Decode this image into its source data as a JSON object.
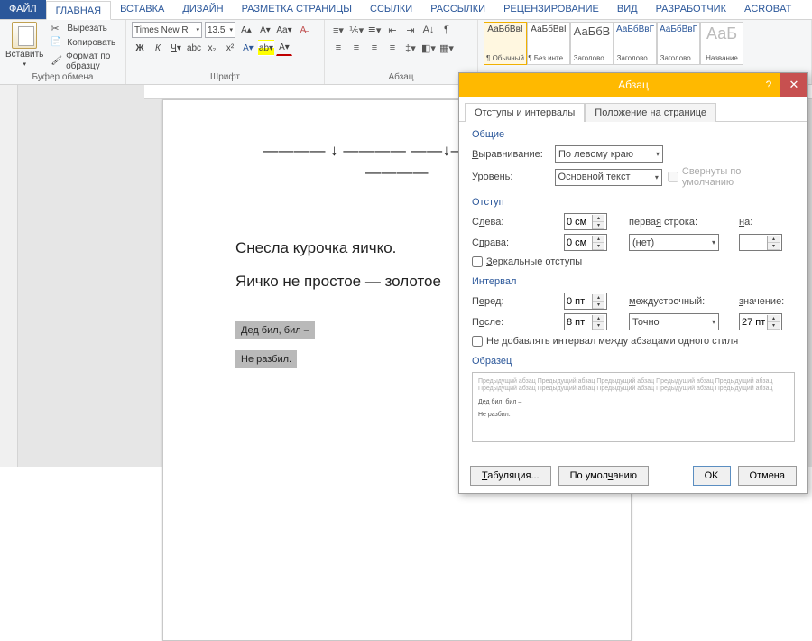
{
  "tabs": {
    "file": "ФАЙЛ",
    "items": [
      "ГЛАВНАЯ",
      "ВСТАВКА",
      "ДИЗАЙН",
      "РАЗМЕТКА СТРАНИЦЫ",
      "ССЫЛКИ",
      "РАССЫЛКИ",
      "РЕЦЕНЗИРОВАНИЕ",
      "ВИД",
      "РАЗРАБОТЧИК",
      "ACROBAT"
    ]
  },
  "clipboard": {
    "paste": "Вставить",
    "cut": "Вырезать",
    "copy": "Копировать",
    "format": "Формат по образцу",
    "group": "Буфер обмена"
  },
  "font": {
    "name": "Times New R",
    "size": "13.5",
    "group": "Шрифт"
  },
  "paragraph_group": "Абзац",
  "styles": [
    {
      "sample": "АаБбВвI",
      "label": "¶ Обычный"
    },
    {
      "sample": "АаБбВвI",
      "label": "¶ Без инте..."
    },
    {
      "sample": "АаБбВ",
      "label": "Заголово..."
    },
    {
      "sample": "АаБбВвГ",
      "label": "Заголово..."
    },
    {
      "sample": "АаБбВвГ",
      "label": "Заголово..."
    },
    {
      "sample": "АаБ",
      "label": "Название"
    }
  ],
  "doc": {
    "topline": "———— ↓ ———— ——↓—— —— ↓ ————",
    "l1": "Снесла курочка яичко.",
    "l2": "Яичко не простое — золотое",
    "l3": "Дед бил, бил –",
    "l4": "Не разбил."
  },
  "dialog": {
    "title": "Абзац",
    "tab1": "Отступы и интервалы",
    "tab2": "Положение на странице",
    "sect_general": "Общие",
    "align_label": "Выравнивание:",
    "align_value": "По левому краю",
    "level_label": "Уровень:",
    "level_value": "Основной текст",
    "collapse": "Свернуты по умолчанию",
    "sect_indent": "Отступ",
    "left_label": "Слева:",
    "left_value": "0 см",
    "right_label": "Справа:",
    "right_value": "0 см",
    "first_label": "первая строка:",
    "first_value": "(нет)",
    "on_label": "на:",
    "mirror": "Зеркальные отступы",
    "sect_interval": "Интервал",
    "before_label": "Перед:",
    "before_value": "0 пт",
    "after_label": "После:",
    "after_value": "8 пт",
    "linesp_label": "междустрочный:",
    "linesp_value": "Точно",
    "val_label": "значение:",
    "val_value": "27 пт",
    "nospace": "Не добавлять интервал между абзацами одного стиля",
    "sect_preview": "Образец",
    "preview_grey": "Предыдущий абзац Предыдущий абзац Предыдущий абзац Предыдущий абзац Предыдущий абзац Предыдущий абзац Предыдущий абзац Предыдущий абзац Предыдущий абзац Предыдущий абзац",
    "preview_l1": "Дед бил, бил –",
    "preview_l2": "Не разбил.",
    "tabs_btn": "Табуляция...",
    "default_btn": "По умолчанию",
    "ok": "OK",
    "cancel": "Отмена"
  }
}
